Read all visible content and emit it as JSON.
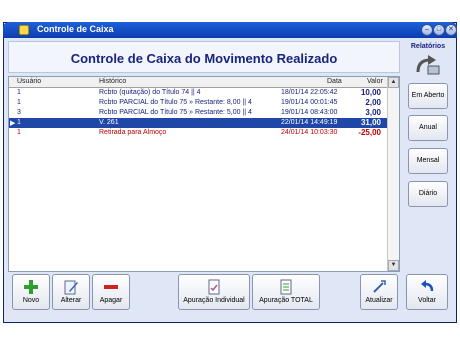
{
  "window": {
    "title": "Controle de Caixa"
  },
  "header": {
    "title": "Controle de Caixa do Movimento Realizado"
  },
  "grid": {
    "columns": {
      "usuario": "Usuário",
      "historico": "Histórico",
      "data": "Data",
      "valor": "Valor"
    },
    "rows": [
      {
        "usuario": "1",
        "historico": "Rcbto (quitação) do Título 74 || 4",
        "data": "18/01/14 22:05:42",
        "valor": "10,00",
        "color": "#1a237e"
      },
      {
        "usuario": "1",
        "historico": "Rcbto PARCIAL do Título 75 » Restante: 8,00 || 4",
        "data": "19/01/14 00:01:45",
        "valor": "2,00",
        "color": "#1a237e"
      },
      {
        "usuario": "3",
        "historico": "Rcbto PARCIAL do Título 75 » Restante: 5,00 || 4",
        "data": "19/01/14 08:43:00",
        "valor": "3,00",
        "color": "#1a237e"
      },
      {
        "usuario": "1",
        "historico": "V. 261",
        "data": "22/01/14 14:49:19",
        "valor": "31,00",
        "color": "#1a237e",
        "selected": true
      },
      {
        "usuario": "1",
        "historico": "Retirada para Almoço",
        "data": "24/01/14 10:03:30",
        "valor": "-25,00",
        "color": "#c00000"
      }
    ]
  },
  "sidebar": {
    "label": "Relatórios",
    "buttons": {
      "em_aberto": "Em Aberto",
      "anual": "Anual",
      "mensal": "Mensal",
      "diario": "Diário"
    }
  },
  "toolbar": {
    "novo": "Novo",
    "alterar": "Alterar",
    "apagar": "Apagar",
    "apuracao_individual": "Apuração Individual",
    "apuracao_total": "Apuração TOTAL",
    "atualizar": "Atualizar",
    "voltar": "Voltar"
  }
}
